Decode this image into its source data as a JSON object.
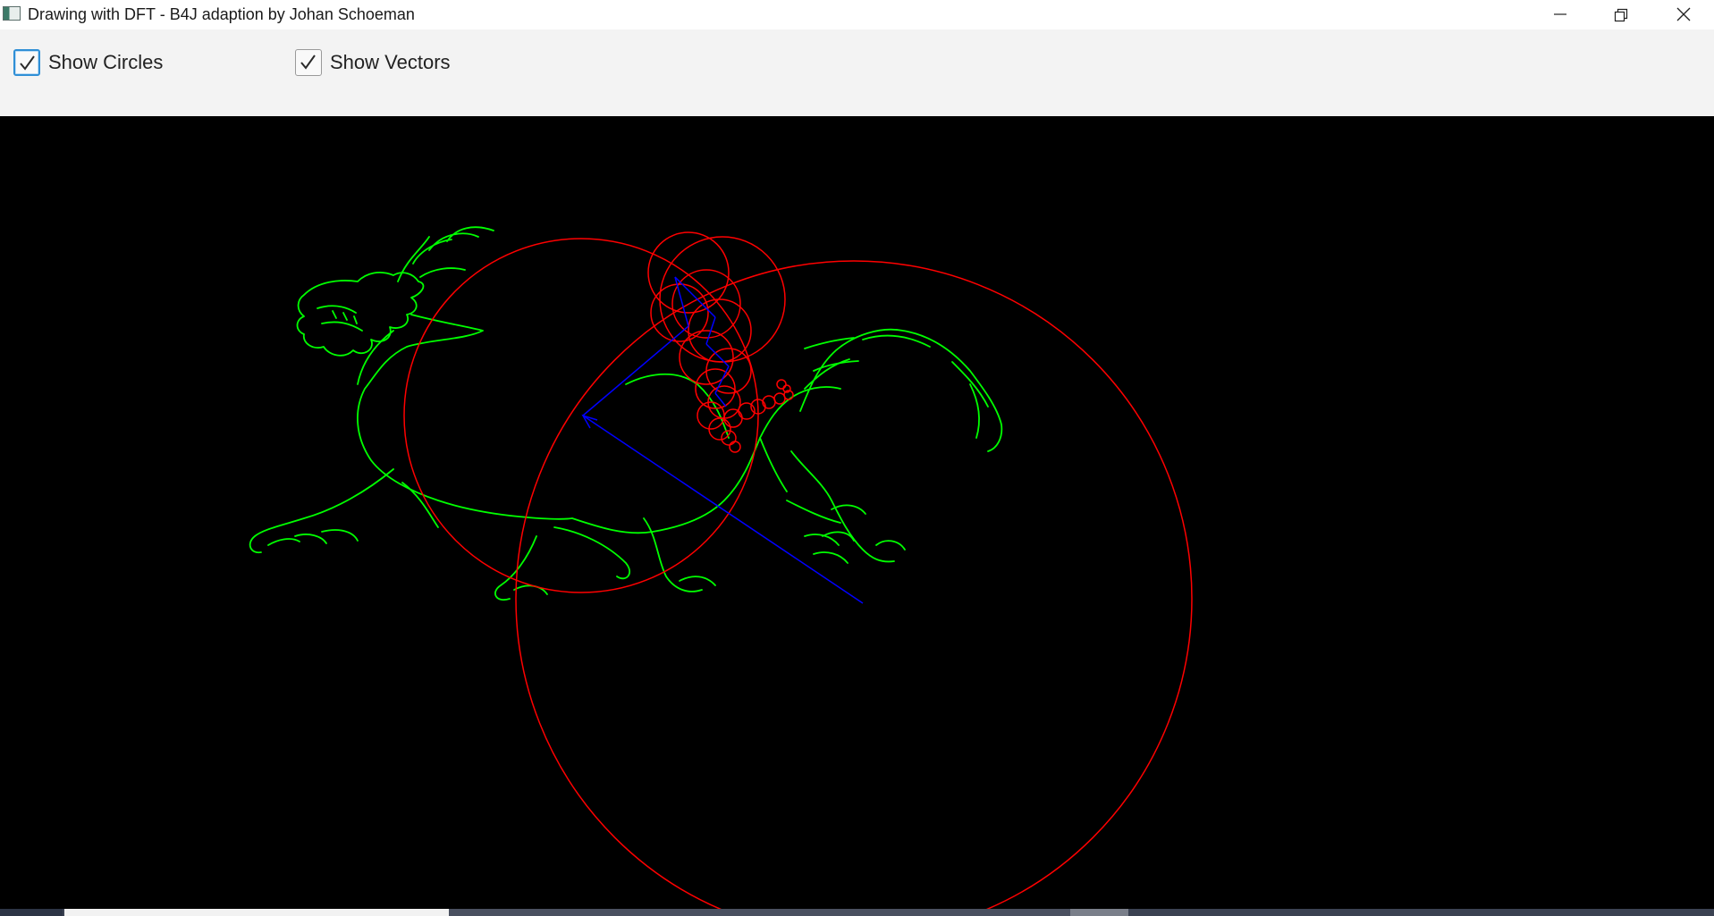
{
  "window": {
    "title": "Drawing with DFT - B4J adaption by Johan Schoeman",
    "icon": "app-window-icon",
    "controls": [
      "minimize-icon",
      "restore-icon",
      "close-icon"
    ]
  },
  "toolbar": {
    "show_circles": {
      "label": "Show Circles",
      "checked": true
    },
    "show_vectors": {
      "label": "Show Vectors",
      "checked": true
    }
  },
  "canvas": {
    "background": "#000000",
    "drawing_color": "#00ff00",
    "circle_color": "#ff0000",
    "vector_color": "#0000ff"
  }
}
